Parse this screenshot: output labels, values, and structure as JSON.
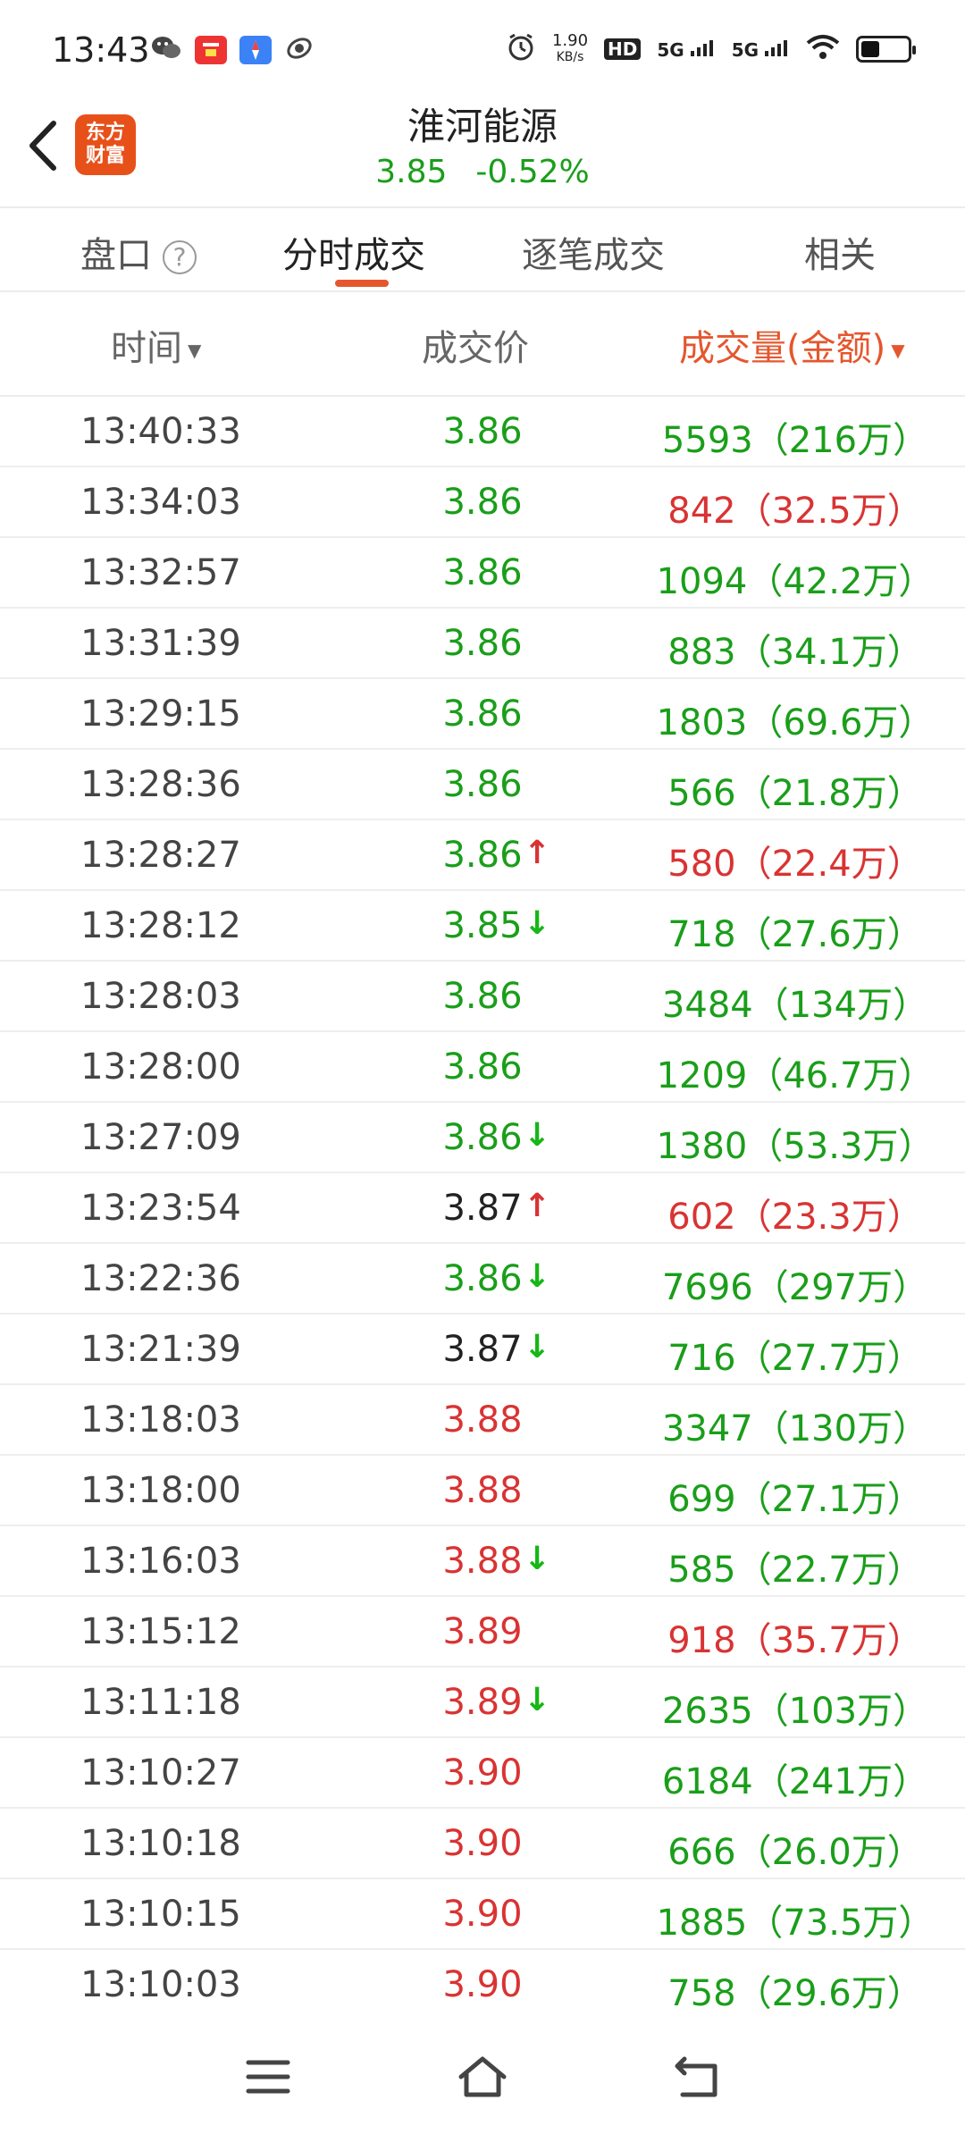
{
  "status_bar": {
    "time": "13:43",
    "net_speed_value": "1.90",
    "net_speed_unit": "KB/s",
    "hd": "HD",
    "sim1": "5G",
    "sim2": "5G",
    "battery_level": 0.4
  },
  "header": {
    "logo_line1": "东方",
    "logo_line2": "财富",
    "title": "淮河能源",
    "price": "3.85",
    "change": "-0.52%"
  },
  "tabs": [
    {
      "label": "盘口"
    },
    {
      "label": "分时成交"
    },
    {
      "label": "逐笔成交"
    },
    {
      "label": "相关"
    }
  ],
  "help_glyph": "?",
  "columns": {
    "time": "时间",
    "price": "成交价",
    "volume": "成交量(金额)"
  },
  "colors": {
    "green": "#1a9e1a",
    "red": "#d93333",
    "accent": "#e4572e"
  },
  "trades": [
    {
      "time": "13:40:33",
      "price": "3.86",
      "pc": "g",
      "arrow": "",
      "vol": "5593（216万）",
      "vc": "g"
    },
    {
      "time": "13:34:03",
      "price": "3.86",
      "pc": "g",
      "arrow": "",
      "vol": "842（32.5万）",
      "vc": "r"
    },
    {
      "time": "13:32:57",
      "price": "3.86",
      "pc": "g",
      "arrow": "",
      "vol": "1094（42.2万）",
      "vc": "g"
    },
    {
      "time": "13:31:39",
      "price": "3.86",
      "pc": "g",
      "arrow": "",
      "vol": "883（34.1万）",
      "vc": "g"
    },
    {
      "time": "13:29:15",
      "price": "3.86",
      "pc": "g",
      "arrow": "",
      "vol": "1803（69.6万）",
      "vc": "g"
    },
    {
      "time": "13:28:36",
      "price": "3.86",
      "pc": "g",
      "arrow": "",
      "vol": "566（21.8万）",
      "vc": "g"
    },
    {
      "time": "13:28:27",
      "price": "3.86",
      "pc": "g",
      "arrow": "up",
      "vol": "580（22.4万）",
      "vc": "r"
    },
    {
      "time": "13:28:12",
      "price": "3.85",
      "pc": "g",
      "arrow": "down",
      "vol": "718（27.6万）",
      "vc": "g"
    },
    {
      "time": "13:28:03",
      "price": "3.86",
      "pc": "g",
      "arrow": "",
      "vol": "3484（134万）",
      "vc": "g"
    },
    {
      "time": "13:28:00",
      "price": "3.86",
      "pc": "g",
      "arrow": "",
      "vol": "1209（46.7万）",
      "vc": "g"
    },
    {
      "time": "13:27:09",
      "price": "3.86",
      "pc": "g",
      "arrow": "down",
      "vol": "1380（53.3万）",
      "vc": "g"
    },
    {
      "time": "13:23:54",
      "price": "3.87",
      "pc": "k",
      "arrow": "up",
      "vol": "602（23.3万）",
      "vc": "r"
    },
    {
      "time": "13:22:36",
      "price": "3.86",
      "pc": "g",
      "arrow": "down",
      "vol": "7696（297万）",
      "vc": "g"
    },
    {
      "time": "13:21:39",
      "price": "3.87",
      "pc": "k",
      "arrow": "down",
      "vol": "716（27.7万）",
      "vc": "g"
    },
    {
      "time": "13:18:03",
      "price": "3.88",
      "pc": "r",
      "arrow": "",
      "vol": "3347（130万）",
      "vc": "g"
    },
    {
      "time": "13:18:00",
      "price": "3.88",
      "pc": "r",
      "arrow": "",
      "vol": "699（27.1万）",
      "vc": "g"
    },
    {
      "time": "13:16:03",
      "price": "3.88",
      "pc": "r",
      "arrow": "down",
      "vol": "585（22.7万）",
      "vc": "g"
    },
    {
      "time": "13:15:12",
      "price": "3.89",
      "pc": "r",
      "arrow": "",
      "vol": "918（35.7万）",
      "vc": "r"
    },
    {
      "time": "13:11:18",
      "price": "3.89",
      "pc": "r",
      "arrow": "down",
      "vol": "2635（103万）",
      "vc": "g"
    },
    {
      "time": "13:10:27",
      "price": "3.90",
      "pc": "r",
      "arrow": "",
      "vol": "6184（241万）",
      "vc": "g"
    },
    {
      "time": "13:10:18",
      "price": "3.90",
      "pc": "r",
      "arrow": "",
      "vol": "666（26.0万）",
      "vc": "g"
    },
    {
      "time": "13:10:15",
      "price": "3.90",
      "pc": "r",
      "arrow": "",
      "vol": "1885（73.5万）",
      "vc": "g"
    },
    {
      "time": "13:10:03",
      "price": "3.90",
      "pc": "r",
      "arrow": "",
      "vol": "758（29.6万）",
      "vc": "g"
    }
  ]
}
